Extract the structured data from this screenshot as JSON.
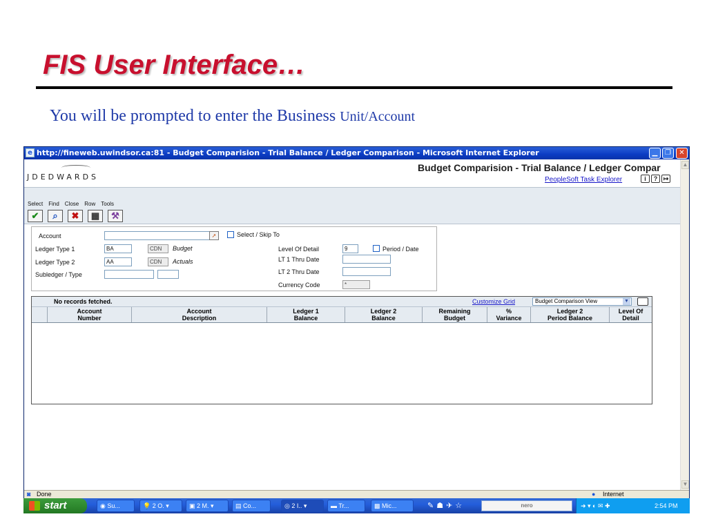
{
  "slide": {
    "title": "FIS User Interface…",
    "subtitle_main": "You will be prompted to enter the Business ",
    "subtitle_small": "Unit/Account"
  },
  "browser": {
    "title": "http://fineweb.uwindsor.ca:81 - Budget Comparision - Trial Balance / Ledger Comparison - Microsoft Internet Explorer",
    "status_left": "Done",
    "status_zone": "Internet"
  },
  "app": {
    "logo": "JDEDWARDS",
    "title": "Budget Comparision - Trial Balance / Ledger Compar",
    "ps_link": "PeopleSoft Task Explorer",
    "menu": [
      "Select",
      "Find",
      "Close",
      "Row",
      "Tools"
    ],
    "toolbar_icons": [
      "check-icon",
      "find-icon",
      "close-x-icon",
      "row-icon",
      "tools-icon"
    ]
  },
  "form": {
    "account_label": "Account",
    "account_value": "",
    "select_skip_label": "Select / Skip To",
    "ledger1_label": "Ledger Type 1",
    "ledger1_value": "BA",
    "ledger1_currency": "CDN",
    "ledger1_desc": "Budget",
    "ledger2_label": "Ledger Type 2",
    "ledger2_value": "AA",
    "ledger2_currency": "CDN",
    "ledger2_desc": "Actuals",
    "subledger_label": "Subledger / Type",
    "level_label": "Level Of Detail",
    "level_value": "9",
    "period_label": "Period / Date",
    "lt1_label": "LT 1 Thru Date",
    "lt2_label": "LT 2 Thru Date",
    "currency_label": "Currency Code",
    "currency_value": "*"
  },
  "grid": {
    "no_records": "No records fetched.",
    "customize": "Customize Grid",
    "view": "Budget Comparison View",
    "columns": [
      [
        "Account",
        "Number"
      ],
      [
        "Account",
        "Description"
      ],
      [
        "Ledger 1",
        "Balance"
      ],
      [
        "Ledger 2",
        "Balance"
      ],
      [
        "Remaining",
        "Budget"
      ],
      [
        "%",
        "Variance"
      ],
      [
        "Ledger 2",
        "Period Balance"
      ],
      [
        "Level Of",
        "Detail"
      ]
    ]
  },
  "taskbar": {
    "start": "start",
    "tasks": [
      "Su...",
      "2 O.",
      "2 M.",
      "Co...",
      "2 I..",
      "Tr...",
      "Mic..."
    ],
    "nero": "nero",
    "clock": "2:54 PM"
  }
}
